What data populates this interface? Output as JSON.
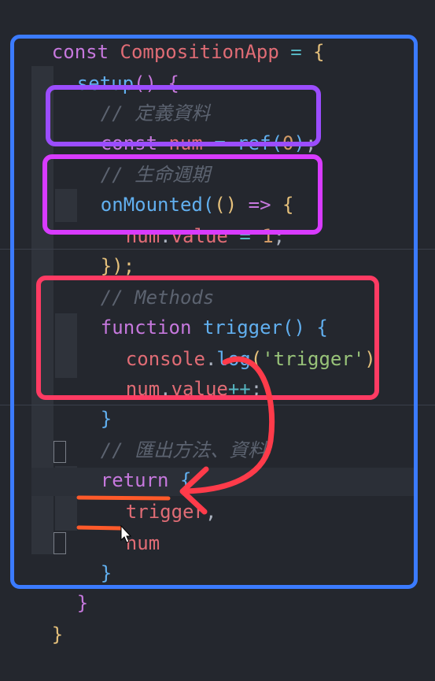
{
  "code": {
    "line1": {
      "kw": "const",
      "name": "CompositionApp",
      "eq": "=",
      "brace": "{"
    },
    "line2": {
      "fn": "setup",
      "parens": "()",
      "brace": "{"
    },
    "line3": {
      "comment": "// 定義資料"
    },
    "line4": {
      "kw": "const",
      "var": "num",
      "eq": "=",
      "fn": "ref",
      "open": "(",
      "num": "0",
      "close": ")",
      "semi": ";"
    },
    "line5": {
      "comment": "// 生命週期"
    },
    "line6": {
      "fn": "onMounted",
      "open": "(",
      "parens": "()",
      "arrow": "=>",
      "brace": "{"
    },
    "line7": {
      "var": "num",
      "dot": ".",
      "prop": "value",
      "eq": "=",
      "num": "1",
      "semi": ";"
    },
    "line8": {
      "text": "});"
    },
    "line9": {
      "comment": "// Methods"
    },
    "line10": {
      "kw": "function",
      "fn": "trigger",
      "parens": "()",
      "brace": "{"
    },
    "line11": {
      "obj": "console",
      "dot": ".",
      "fn": "log",
      "open": "(",
      "str": "'trigger'",
      "close": ")"
    },
    "line12": {
      "var": "num",
      "dot": ".",
      "prop": "value",
      "op": "++",
      "semi": ";"
    },
    "line13": {
      "brace": "}"
    },
    "line14": {
      "comment": "// 匯出方法、資料"
    },
    "line15": {
      "kw": "return",
      "brace": "{"
    },
    "line16": {
      "var": "trigger",
      "comma": ","
    },
    "line17": {
      "var": "num"
    },
    "line18": {
      "brace": "}"
    },
    "line19": {
      "brace": "}"
    },
    "line20": {
      "brace": "}"
    }
  },
  "annotation_colors": {
    "outer_box": "#3b7bff",
    "box_define": "#9b4dff",
    "box_lifecycle": "#d83bff",
    "box_methods": "#ff3b63",
    "arrow": "#ff3b4a",
    "underline": "#ff5a2a"
  }
}
